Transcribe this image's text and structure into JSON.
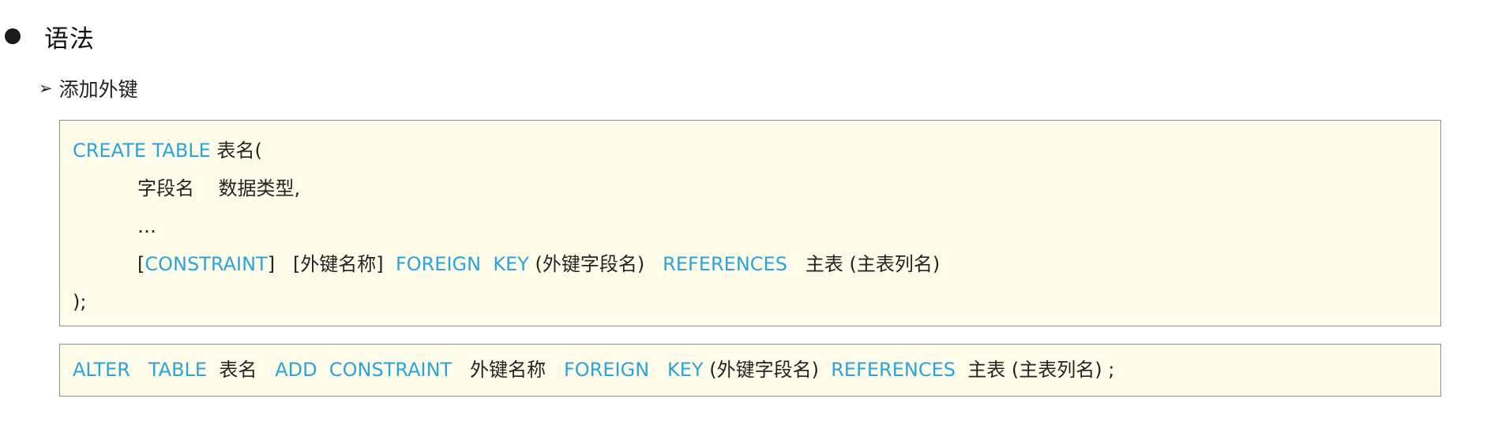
{
  "section": {
    "heading": "语法",
    "subheading": "添加外键",
    "subheading_bullet": "➢"
  },
  "create_block": {
    "line1": {
      "kw": "CREATE TABLE",
      "text": "表名("
    },
    "line2": {
      "text": "字段名    数据类型,"
    },
    "line3": {
      "text": "…"
    },
    "line4": {
      "bracket_open": "[",
      "kw_constraint": "CONSTRAINT",
      "bracket_close": "]",
      "fk_name": "   [外键名称]  ",
      "kw_foreign_key": "FOREIGN  KEY",
      "fk_cols": " (外键字段名)   ",
      "kw_references": "REFERENCES",
      "ref": "   主表 (主表列名)"
    },
    "line5": {
      "text": ");"
    }
  },
  "alter_block": {
    "kw_alter_table": "ALTER   TABLE",
    "table_name": "  表名   ",
    "kw_add_constraint": "ADD  CONSTRAINT",
    "fk_name": "   外键名称   ",
    "kw_foreign_key": "FOREIGN   KEY",
    "fk_cols": " (外键字段名)  ",
    "kw_references": "REFERENCES",
    "ref": "  主表 (主表列名) ;"
  },
  "colors": {
    "keyword": "#2aa4dc",
    "box_background": "#fffde9",
    "box_border": "#8e8e8e",
    "text": "#222222"
  }
}
